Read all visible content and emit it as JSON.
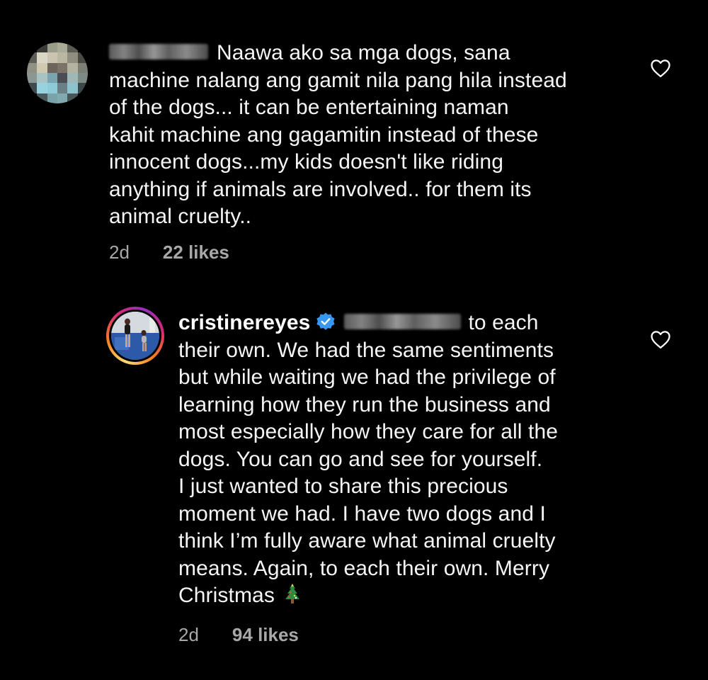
{
  "colors": {
    "background": "#000000",
    "text": "#f5f5f5",
    "meta": "#a8a8a8",
    "verified_badge": "#3897f0"
  },
  "comments": [
    {
      "username_blurred": true,
      "verified": false,
      "lines": [
        "Naawa ako sa mga dogs, sana",
        "machine nalang ang gamit nila pang hila instead",
        "of the dogs... it can be entertaining naman",
        "kahit machine ang gagamitin instead of these",
        "innocent dogs...my kids doesn't like riding",
        "anything if animals are involved.. for them its",
        "animal cruelty.."
      ],
      "time": "2d",
      "likes": "22 likes",
      "like_icon": "heart-outline-icon"
    },
    {
      "username": "cristinereyes",
      "verified": true,
      "mention_blurred": true,
      "lines": [
        "to each",
        "their own. We had the same sentiments",
        "but while waiting we had the privilege of",
        "learning how they run the business and",
        "most especially how they care for all the",
        "dogs. You can go and see for yourself.",
        "I just wanted to share this precious",
        "moment we had. I have two dogs and I",
        "think I’m fully aware what animal cruelty",
        "means. Again, to each their own. Merry",
        "Christmas"
      ],
      "emoji": "christmas-tree-icon",
      "time": "2d",
      "likes": "94 likes",
      "like_icon": "heart-outline-icon"
    }
  ]
}
